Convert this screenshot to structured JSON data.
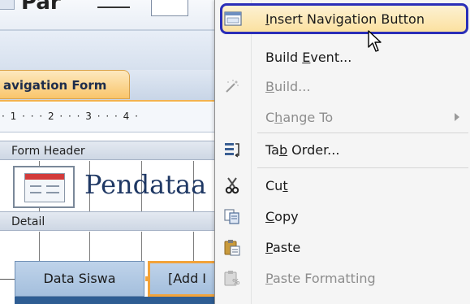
{
  "designer": {
    "tab_label": "avigation Form",
    "ruler_text": "· 1 · · · 2 · · · 3 · · · 4 ·",
    "form_header_label": "Form Header",
    "title_text": "Pendataa",
    "detail_label": "Detail",
    "nav_button_1": "Data Siswa",
    "nav_button_2": "[Add I",
    "ribbon_font_glyph": "Par"
  },
  "context_menu": {
    "items": [
      {
        "key": "insert_navigation_button",
        "label_u": "I",
        "label_rest": "nsert Navigation Button",
        "icon": "insert-nav-button-icon",
        "enabled": true,
        "highlighted": true
      },
      {
        "key": "build_event",
        "label_pre": "Build ",
        "label_u": "E",
        "label_rest": "vent...",
        "icon": "",
        "enabled": true
      },
      {
        "key": "build",
        "label_u": "B",
        "label_rest": "uild...",
        "icon": "build-wand-icon",
        "enabled": false
      },
      {
        "key": "change_to",
        "label_pre": "C",
        "label_u": "h",
        "label_rest": "ange To",
        "icon": "",
        "enabled": false,
        "submenu": true
      },
      {
        "key": "tab_order",
        "label_pre": "Ta",
        "label_u": "b",
        "label_rest": " Order...",
        "icon": "tab-order-icon",
        "enabled": true
      },
      {
        "key": "cut",
        "label_pre": "Cu",
        "label_u": "t",
        "label_rest": "",
        "icon": "scissors-icon",
        "enabled": true
      },
      {
        "key": "copy",
        "label_pre": "",
        "label_u": "C",
        "label_rest": "opy",
        "icon": "copy-icon",
        "enabled": true
      },
      {
        "key": "paste",
        "label_pre": "",
        "label_u": "P",
        "label_rest": "aste",
        "icon": "clipboard-icon",
        "enabled": true
      },
      {
        "key": "paste_formatting",
        "label_pre": "",
        "label_u": "P",
        "label_rest": "aste Formatting",
        "icon": "paste-formatting-icon",
        "enabled": false
      }
    ]
  },
  "colors": {
    "highlight_border": "#2a2eb8",
    "highlight_fill": "#fbe1a0",
    "tab_orange": "#f9c56b",
    "nav_button_blue": "#a4bfdd"
  }
}
